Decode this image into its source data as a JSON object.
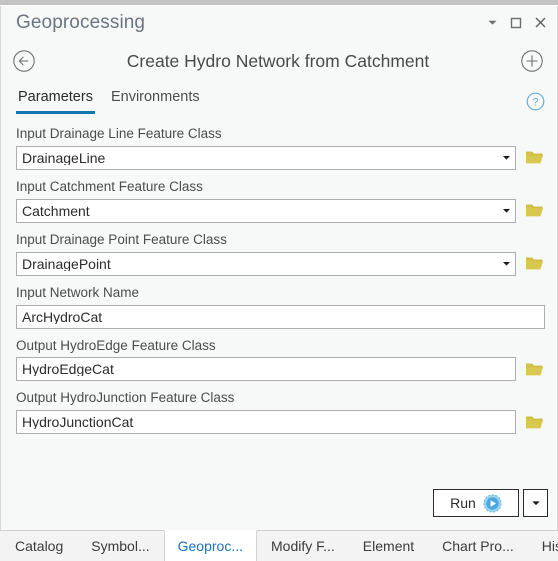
{
  "window": {
    "title": "Geoprocessing",
    "controls": [
      {
        "name": "pane-menu-button",
        "icon": "chevron-down-icon"
      },
      {
        "name": "maximize-button",
        "icon": "maximize-icon"
      },
      {
        "name": "close-button",
        "icon": "close-icon"
      }
    ]
  },
  "tool": {
    "back_icon": "back-arrow-circle-icon",
    "title": "Create Hydro Network from Catchment",
    "add_icon": "plus-circle-icon"
  },
  "tabs": {
    "items": [
      {
        "label": "Parameters",
        "active": true
      },
      {
        "label": "Environments",
        "active": false
      }
    ],
    "help_icon": "help-circle-icon",
    "active_underline_color": "#1376ad"
  },
  "parameters": [
    {
      "label": "Input Drainage Line Feature Class",
      "value": "DrainageLine",
      "has_dropdown": true,
      "has_browse": true
    },
    {
      "label": "Input Catchment Feature Class",
      "value": "Catchment",
      "has_dropdown": true,
      "has_browse": true
    },
    {
      "label": "Input Drainage Point Feature Class",
      "value": "DrainagePoint",
      "has_dropdown": true,
      "has_browse": true
    },
    {
      "label": "Input Network Name",
      "value": "ArcHydroCat",
      "has_dropdown": false,
      "has_browse": false
    },
    {
      "label": "Output HydroEdge Feature Class",
      "value": "HydroEdgeCat",
      "has_dropdown": false,
      "has_browse": true
    },
    {
      "label": "Output HydroJunction Feature Class",
      "value": "HydroJunctionCat",
      "has_dropdown": false,
      "has_browse": true
    }
  ],
  "run": {
    "label": "Run",
    "run_icon": "play-circle-icon",
    "dropdown_icon": "chevron-down-icon"
  },
  "dock_tabs": [
    {
      "label": "Catalog",
      "active": false
    },
    {
      "label": "Symbol...",
      "active": false
    },
    {
      "label": "Geoproc...",
      "active": true
    },
    {
      "label": "Modify F...",
      "active": false
    },
    {
      "label": "Element",
      "active": false
    },
    {
      "label": "Chart Pro...",
      "active": false
    },
    {
      "label": "History",
      "active": false
    }
  ],
  "colors": {
    "accent_blue": "#1376ad",
    "folder_gold": "#d6c246",
    "pane_background": "#f7f8f8",
    "title_gray": "#6b7680"
  }
}
